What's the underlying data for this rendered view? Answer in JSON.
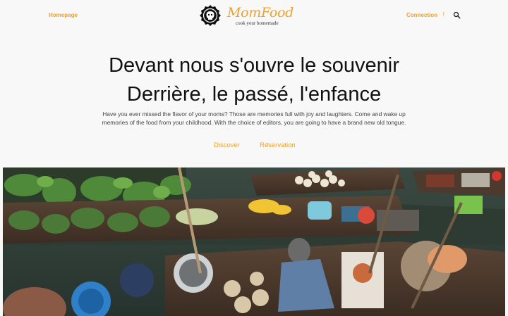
{
  "header": {
    "nav_left": "Homepage",
    "logo_name": "MomFood",
    "logo_tagline": "cook your homemade",
    "connection": "Connection",
    "arrow_icon": "↑",
    "search_icon": "search-icon"
  },
  "hero": {
    "title_line1": "Devant nous s'ouvre le souvenir",
    "title_line2": "Derrière, le passé, l'enfance",
    "description": "Have you ever missed the flavor of your moms? Those are memories full with joy and laughters. Come and wake up memories of the food from your childhood. With the choice of editors, you are going to have a brand new old tongue.",
    "cta_discover": "Discover",
    "cta_arrow": "↑",
    "cta_reservation": "Reservation"
  },
  "colors": {
    "accent": "#f0a030",
    "text": "#111111",
    "background": "#f8f8f8"
  }
}
